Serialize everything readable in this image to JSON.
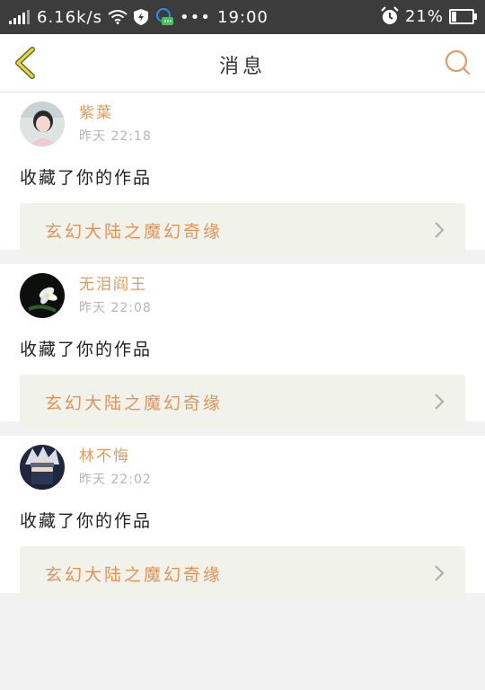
{
  "status_bar": {
    "speed": "6.16k/s",
    "time": "19:00",
    "battery": "21%",
    "battery_level": 0.21
  },
  "header": {
    "title": "消息"
  },
  "messages": [
    {
      "username": "紫葉",
      "time": "昨天 22:18",
      "action": "收藏了你的作品",
      "work_title": "玄幻大陆之魔幻奇缘"
    },
    {
      "username": "无泪阎王",
      "time": "昨天 22:08",
      "action": "收藏了你的作品",
      "work_title": "玄幻大陆之魔幻奇缘"
    },
    {
      "username": "林不悔",
      "time": "昨天 22:02",
      "action": "收藏了你的作品",
      "work_title": "玄幻大陆之魔幻奇缘"
    }
  ],
  "colors": {
    "accent": "#e39a57",
    "status_bar_bg": "#3c3c3c",
    "link_card_bg": "#f1f2ea"
  }
}
